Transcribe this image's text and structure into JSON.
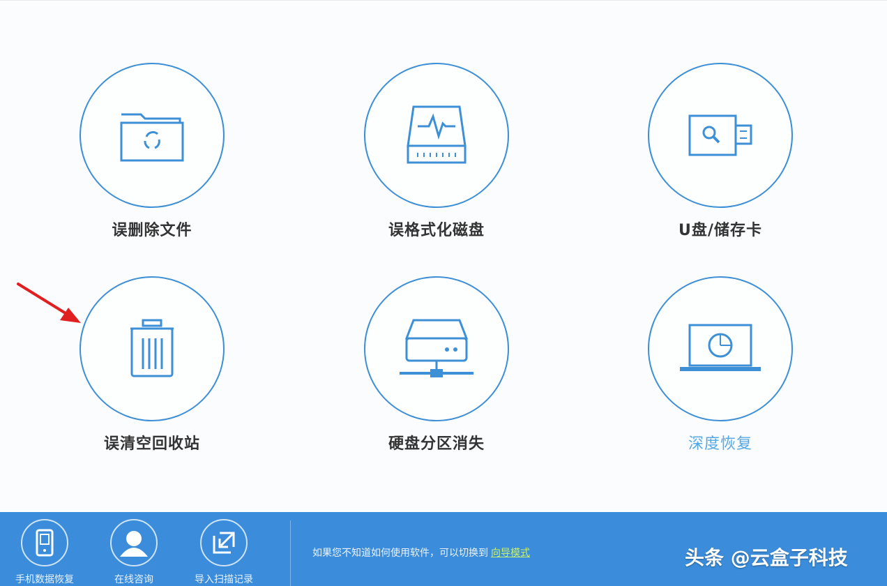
{
  "tiles": [
    {
      "label": "误删除文件",
      "icon": "folder-recycle-icon"
    },
    {
      "label": "误格式化磁盘",
      "icon": "disk-pulse-icon"
    },
    {
      "label": "U盘/储存卡",
      "icon": "usb-search-icon"
    },
    {
      "label": "误清空回收站",
      "icon": "trash-icon"
    },
    {
      "label": "硬盘分区消失",
      "icon": "network-drive-icon"
    },
    {
      "label": "深度恢复",
      "icon": "laptop-scan-icon"
    }
  ],
  "bottom_bar": {
    "buttons": [
      {
        "label": "手机数据恢复",
        "icon": "phone-icon"
      },
      {
        "label": "在线咨询",
        "icon": "user-support-icon"
      },
      {
        "label": "导入扫描记录",
        "icon": "import-icon"
      }
    ],
    "hint_text": "如果您不知道如何使用软件，可以切换到",
    "hint_link": "向导模式",
    "watermark": "头条 @云盒子科技"
  },
  "colors": {
    "accent": "#3d8fd6",
    "bottom_bar": "#3b8ddb",
    "active_label": "#55a8e4",
    "arrow": "#e02020"
  }
}
